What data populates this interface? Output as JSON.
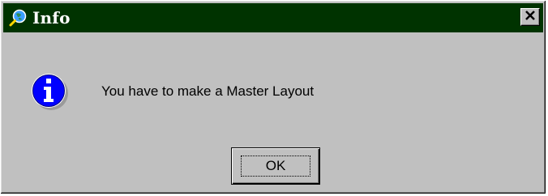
{
  "window": {
    "title": "Info",
    "app_icon": "magnifier-globe-icon",
    "close_icon": "close-icon",
    "title_bar_color": "#003300"
  },
  "message": {
    "icon": "information-icon",
    "text": "You have to make a Master Layout"
  },
  "buttons": {
    "ok_label": "OK"
  },
  "colors": {
    "dialog_bg": "#c0c0c0",
    "info_icon_blue": "#0000ff"
  }
}
